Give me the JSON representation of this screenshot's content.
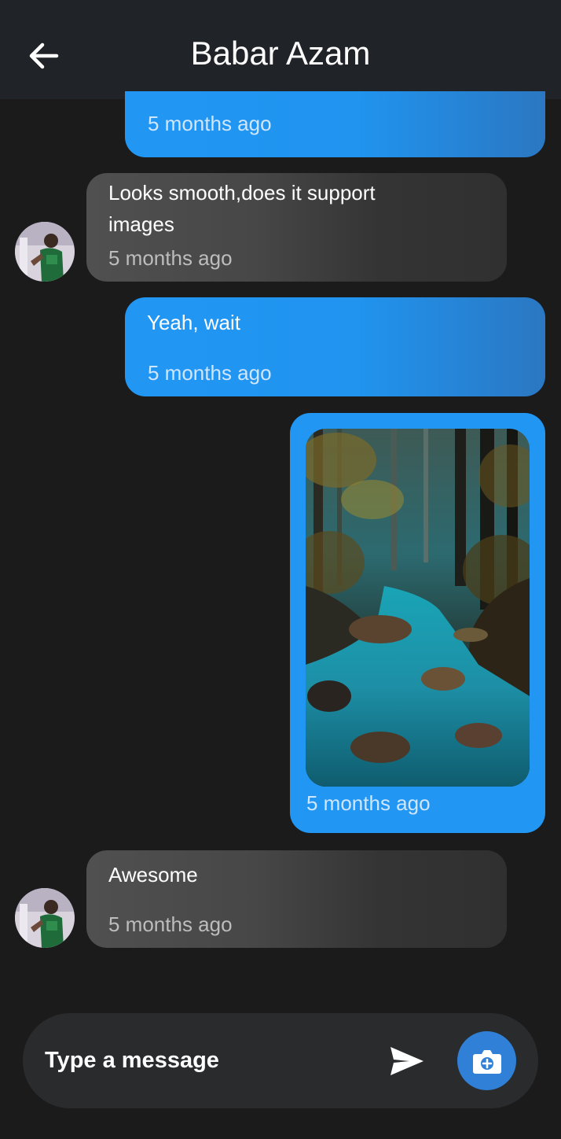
{
  "header": {
    "title": "Babar Azam",
    "back_icon": "arrow-left-icon"
  },
  "messages": [
    {
      "direction": "out",
      "text": "",
      "time": "5 months ago"
    },
    {
      "direction": "in",
      "text": "Looks smooth,does it support images",
      "time": "5 months ago"
    },
    {
      "direction": "out",
      "text": "Yeah, wait",
      "time": "5 months ago"
    },
    {
      "direction": "out",
      "type": "image",
      "image_desc": "forest stream",
      "time": "5 months ago"
    },
    {
      "direction": "in",
      "text": "Awesome",
      "time": "5 months ago"
    }
  ],
  "composer": {
    "placeholder": "Type a message",
    "send_icon": "send-icon",
    "camera_icon": "camera-icon"
  },
  "colors": {
    "header_bg": "#202327",
    "background": "#1b1b1c",
    "outgoing_bubble": "#2196f3",
    "incoming_bubble": "#474747",
    "camera_button": "#2f80d6"
  }
}
